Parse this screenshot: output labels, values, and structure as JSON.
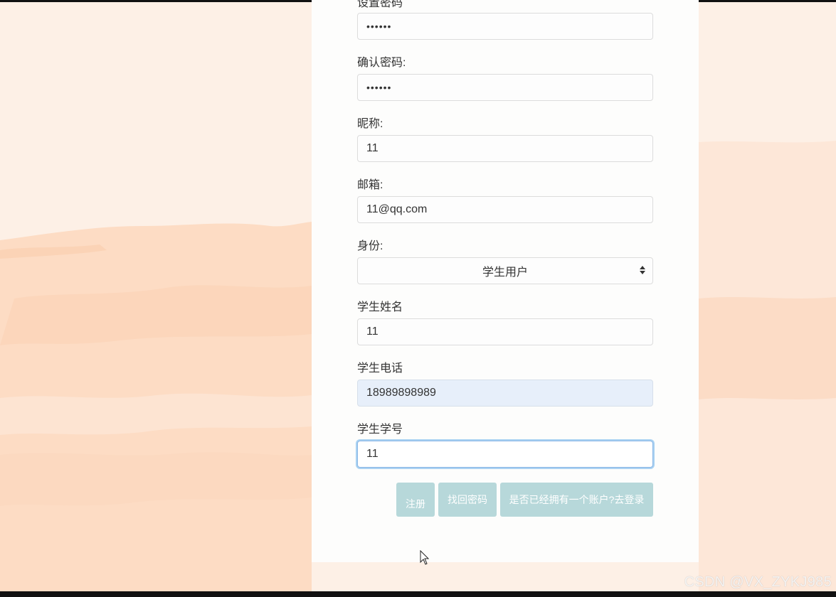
{
  "form": {
    "partial_label": "设置密码",
    "password_value": "••••••",
    "confirm_label": "确认密码:",
    "confirm_value": "••••••",
    "nickname_label": "昵称:",
    "nickname_value": "11",
    "email_label": "邮箱:",
    "email_value": "11@qq.com",
    "identity_label": "身份:",
    "identity_selected": "学生用户",
    "student_name_label": "学生姓名",
    "student_name_value": "11",
    "student_phone_label": "学生电话",
    "student_phone_value": "18989898989",
    "student_id_label": "学生学号",
    "student_id_value": "11"
  },
  "buttons": {
    "register": "注册",
    "recover": "找回密码",
    "login": "是否已经拥有一个账户?去登录"
  },
  "watermark": "CSDN @VX_ZYKJ985",
  "colors": {
    "background": "#fdf0e6",
    "brush": "#fddcc4",
    "button": "#b7d8da",
    "autofill": "#e7effa",
    "focus": "#66afe9"
  }
}
